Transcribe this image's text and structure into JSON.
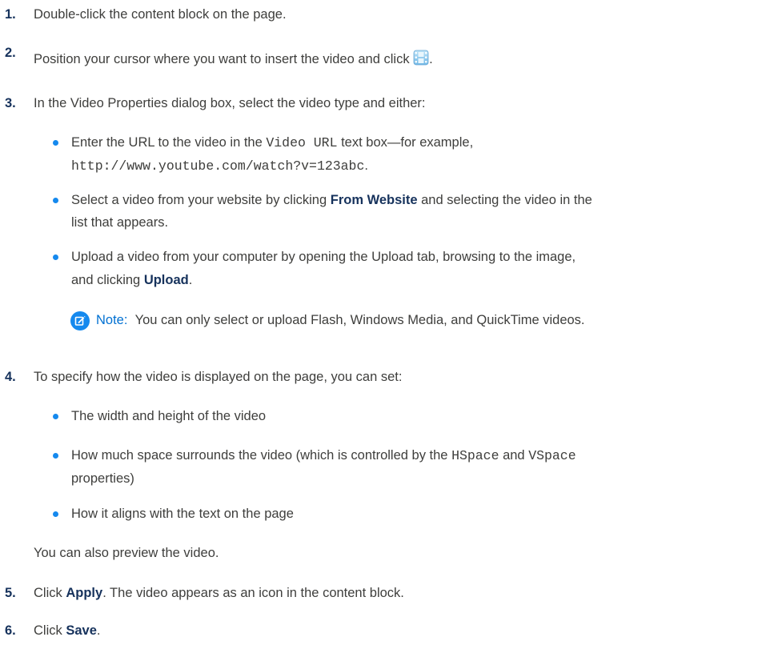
{
  "steps": [
    {
      "num": "1.",
      "text": "Double-click the content block on the page."
    },
    {
      "num": "2.",
      "text_before": "Position your cursor where you want to insert the video and click",
      "text_after": ".",
      "icon": "video-filmstrip-icon"
    },
    {
      "num": "3.",
      "text": "In the Video Properties dialog box, select the video type and either:"
    },
    {
      "num": "4.",
      "text": "To specify how the video is displayed on the page, you can set:"
    },
    {
      "num": "5.",
      "text_before": "Click ",
      "bold": "Apply",
      "text_after": ". The video appears as an icon in the content block."
    },
    {
      "num": "6.",
      "text_before": "Click ",
      "bold": "Save",
      "text_after": "."
    }
  ],
  "step3_bullets": {
    "b1": {
      "l1_before": "Enter the URL to the video in the ",
      "l1_code": "Video URL",
      "l1_after": " text box—for example,",
      "l2_code": "http://www.youtube.com/watch?v=123abc",
      "l2_after": "."
    },
    "b2": {
      "l1_before": "Select a video from your website by clicking ",
      "l1_bold": "From Website",
      "l1_after": " and selecting the video in the",
      "l2": "list that appears."
    },
    "b3": {
      "l1": "Upload a video from your computer by opening the Upload tab, browsing to the image,",
      "l2_before": "and clicking ",
      "l2_bold": "Upload",
      "l2_after": "."
    }
  },
  "note": {
    "label": "Note:",
    "text": "You can only select or upload Flash, Windows Media, and QuickTime videos.",
    "icon": "note-edit-icon"
  },
  "step4_bullets": {
    "b1": "The width and height of the video",
    "b2": {
      "l1_before": "How much space surrounds the video (which is controlled by the ",
      "l1_code1": "HSpace",
      "l1_mid": " and ",
      "l1_code2": "VSpace",
      "l2": "properties)"
    },
    "b3": "How it aligns with the text on the page"
  },
  "step4_after": "You can also preview the video.",
  "colors": {
    "text": "#3e3e3c",
    "heading": "#16325c",
    "bullet": "#1589ee",
    "note": "#0070d2"
  }
}
